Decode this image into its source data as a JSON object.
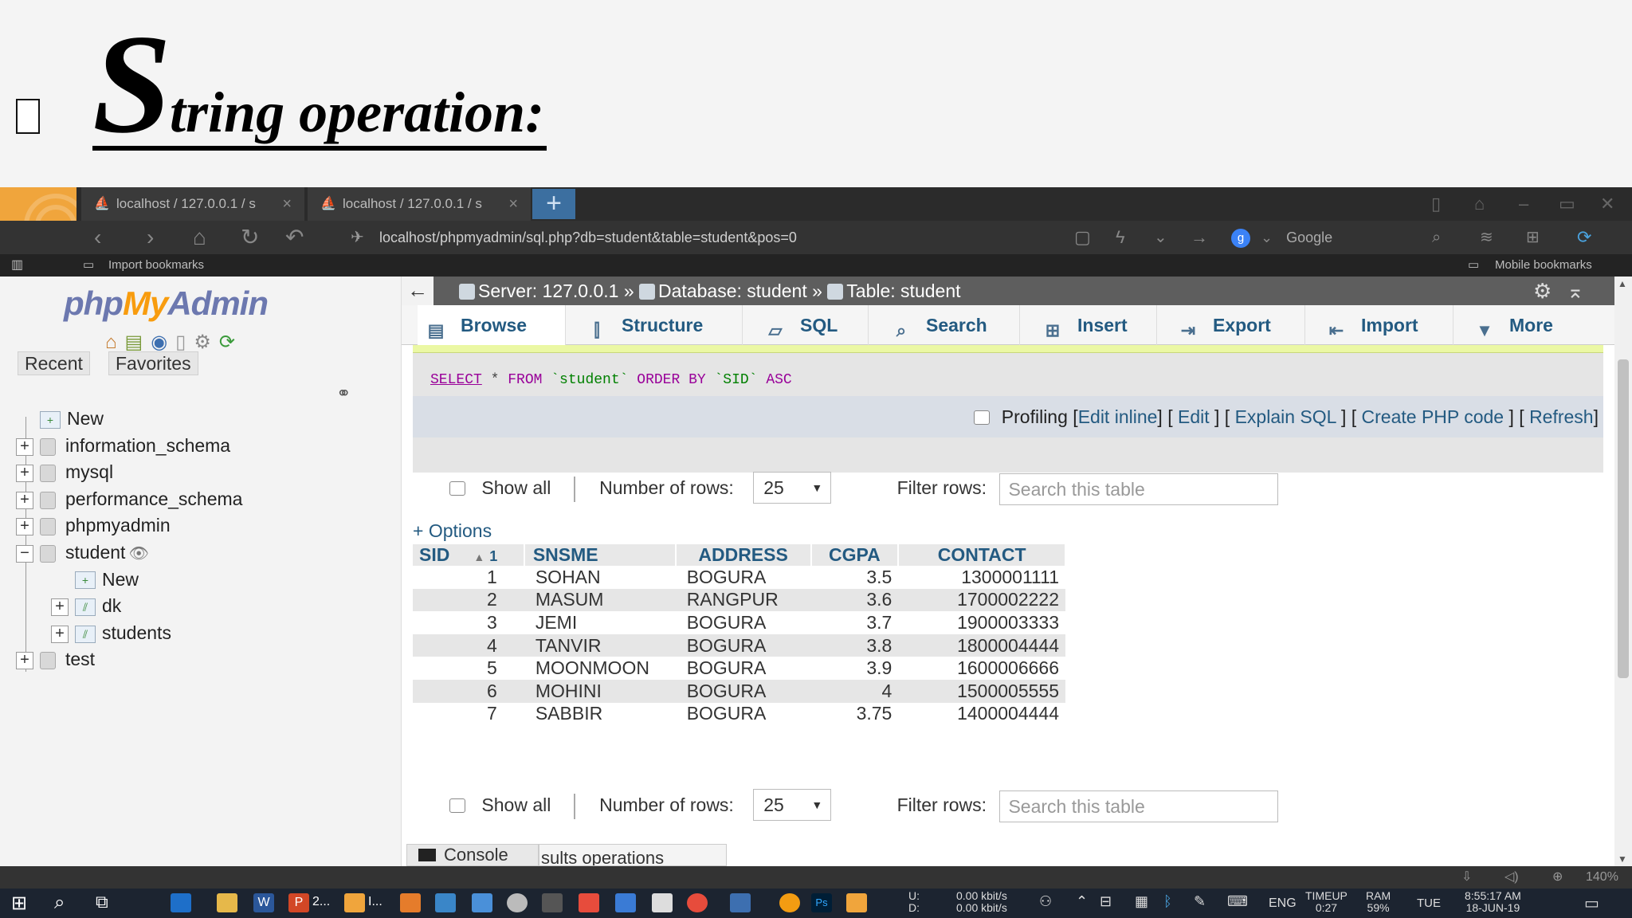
{
  "slide": {
    "title_big": "S",
    "title_rest": "tring operation:"
  },
  "browser": {
    "tabs": [
      {
        "label": "localhost / 127.0.0.1 / s"
      },
      {
        "label": "localhost / 127.0.0.1 / s"
      }
    ],
    "new_tab_label": "+",
    "address": "localhost/phpmyadmin/sql.php?db=student&table=student&pos=0",
    "search_engine_label": "Google",
    "bookmarks": {
      "import_label": "Import bookmarks",
      "mobile_label": "Mobile bookmarks"
    },
    "status_zoom": "140%"
  },
  "pma": {
    "logo_php": "php",
    "logo_my": "My",
    "logo_admin": "Admin",
    "recent_label": "Recent",
    "favorites_label": "Favorites",
    "tree": [
      {
        "label": "New",
        "kind": "new",
        "level": 0
      },
      {
        "label": "information_schema",
        "kind": "db",
        "level": 0
      },
      {
        "label": "mysql",
        "kind": "db",
        "level": 0
      },
      {
        "label": "performance_schema",
        "kind": "db",
        "level": 0
      },
      {
        "label": "phpmyadmin",
        "kind": "db",
        "level": 0
      },
      {
        "label": "student",
        "kind": "db-open",
        "level": 0
      },
      {
        "label": "New",
        "kind": "new",
        "level": 1
      },
      {
        "label": "dk",
        "kind": "table",
        "level": 1
      },
      {
        "label": "students",
        "kind": "table",
        "level": 1
      },
      {
        "label": "test",
        "kind": "db",
        "level": 0
      }
    ],
    "breadcrumb": {
      "server": "Server: 127.0.0.1",
      "database": "Database: student",
      "table": "Table: student",
      "sep": "»"
    },
    "tabs": [
      "Browse",
      "Structure",
      "SQL",
      "Search",
      "Insert",
      "Export",
      "Import",
      "More"
    ],
    "sql_query": {
      "select": "SELECT",
      "star": " * ",
      "from": "FROM",
      "table": " `student` ",
      "order": "ORDER BY",
      "col": " `SID` ",
      "asc": "ASC"
    },
    "sql_actions": {
      "profiling": "Profiling",
      "edit_inline": "Edit inline",
      "edit": "Edit",
      "explain": "Explain SQL",
      "create_php": "Create PHP code",
      "refresh": "Refresh"
    },
    "nav": {
      "show_all": "Show all",
      "rows_label": "Number of rows:",
      "rows_value": "25",
      "filter_label": "Filter rows:",
      "filter_placeholder": "Search this table"
    },
    "options_label": "+ Options",
    "columns": [
      "SID",
      "SNSME",
      "ADDRESS",
      "CGPA",
      "CONTACT"
    ],
    "sort_index": "1",
    "rows": [
      [
        "1",
        "SOHAN",
        "BOGURA",
        "3.5",
        "1300001111"
      ],
      [
        "2",
        "MASUM",
        "RANGPUR",
        "3.6",
        "1700002222"
      ],
      [
        "3",
        "JEMI",
        "BOGURA",
        "3.7",
        "1900003333"
      ],
      [
        "4",
        "TANVIR",
        "BOGURA",
        "3.8",
        "1800004444"
      ],
      [
        "5",
        "MOONMOON",
        "BOGURA",
        "3.9",
        "1600006666"
      ],
      [
        "6",
        "MOHINI",
        "BOGURA",
        "4",
        "1500005555"
      ],
      [
        "7",
        "SABBIR",
        "BOGURA",
        "3.75",
        "1400004444"
      ]
    ],
    "console_label": "Console",
    "ops_label": "sults operations"
  },
  "taskbar": {
    "ppt_label": "2...",
    "browser_label": "I...",
    "net_up": "0.00 kbit/s",
    "net_down": "0.00 kbit/s",
    "drive_u": "U:",
    "drive_d": "D:",
    "lang": "ENG",
    "timeup_label": "TIMEUP",
    "timeup_value": "0:27",
    "ram_label": "RAM",
    "ram_value": "59%",
    "day": "TUE",
    "time": "8:55:17 AM",
    "date": "18-JUN-19"
  }
}
